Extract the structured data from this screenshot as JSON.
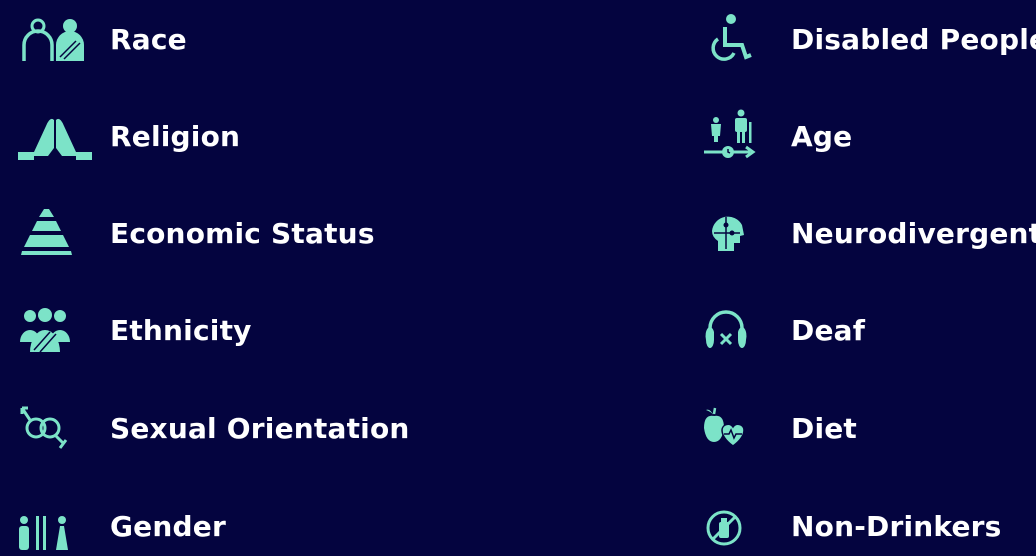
{
  "accent_color": "#7ce3c8",
  "background_color": "#04043f",
  "left_items": [
    {
      "label": "Race",
      "icon": "race-icon"
    },
    {
      "label": "Religion",
      "icon": "praying-hands-icon"
    },
    {
      "label": "Economic Status",
      "icon": "pyramid-icon"
    },
    {
      "label": "Ethnicity",
      "icon": "people-group-icon"
    },
    {
      "label": "Sexual Orientation",
      "icon": "gender-symbols-icon"
    },
    {
      "label": "Gender",
      "icon": "gender-figures-icon"
    }
  ],
  "right_items": [
    {
      "label": "Disabled People",
      "icon": "wheelchair-icon"
    },
    {
      "label": "Age",
      "icon": "age-timeline-icon"
    },
    {
      "label": "Neurodivergent",
      "icon": "puzzle-head-icon"
    },
    {
      "label": "Deaf",
      "icon": "deaf-headphones-icon"
    },
    {
      "label": "Diet",
      "icon": "apple-heart-icon"
    },
    {
      "label": "Non-Drinkers",
      "icon": "no-bottle-icon"
    }
  ]
}
